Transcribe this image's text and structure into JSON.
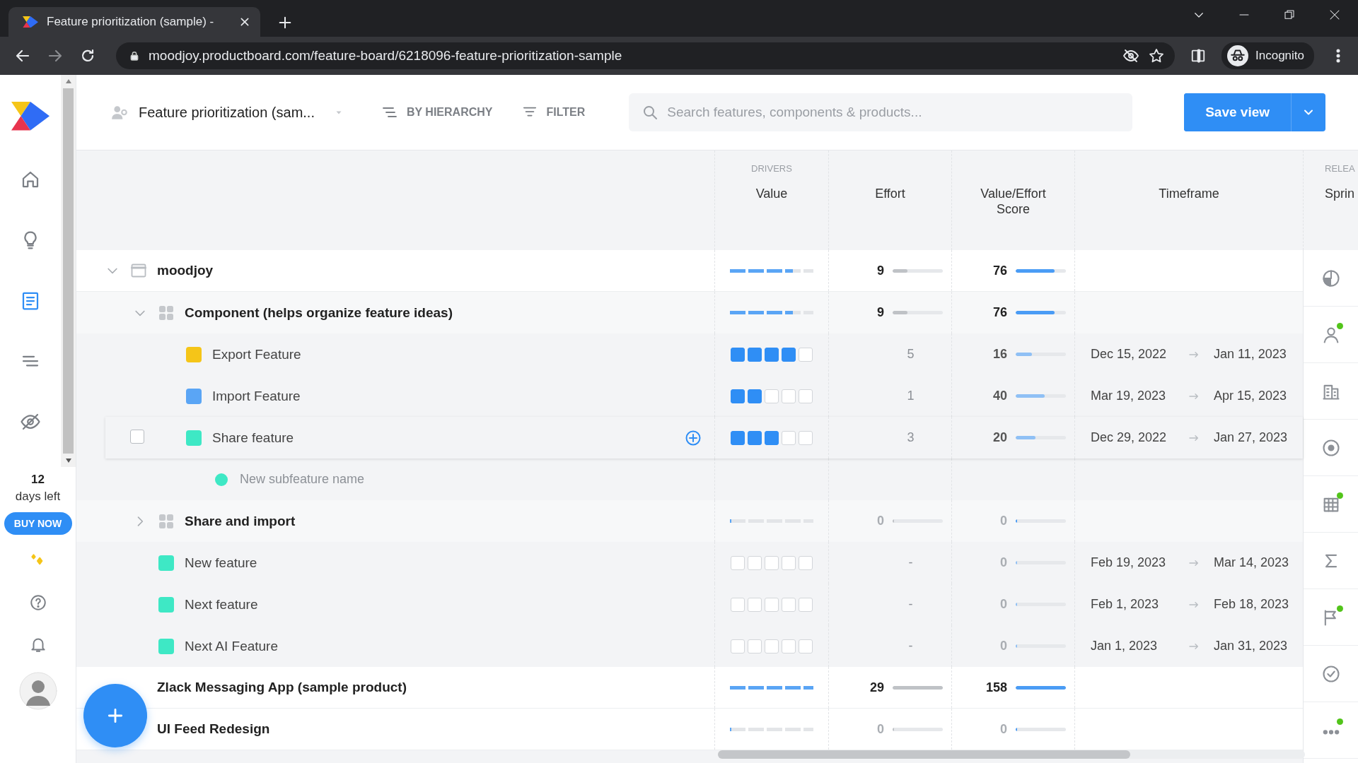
{
  "browser": {
    "tab_title": "Feature prioritization (sample) -",
    "url": "moodjoy.productboard.com/feature-board/6218096-feature-prioritization-sample",
    "profile": "Incognito"
  },
  "nav": {
    "items": [
      {
        "kind": "home",
        "selected": false
      },
      {
        "kind": "insights",
        "selected": false
      },
      {
        "kind": "features",
        "selected": true
      },
      {
        "kind": "roadmap",
        "selected": false
      },
      {
        "kind": "portal",
        "selected": false
      }
    ],
    "trial_days": "12",
    "trial_label": "days left",
    "buy_button": "BUY NOW",
    "bottom_items": [
      {
        "kind": "whats-new"
      },
      {
        "kind": "help"
      },
      {
        "kind": "notifications"
      }
    ]
  },
  "header": {
    "board_title": "Feature prioritization (sam...",
    "group_by": "BY HIERARCHY",
    "filter": "FILTER",
    "search": {
      "placeholder": "Search features, components & products..."
    },
    "save_button": "Save view"
  },
  "columns": {
    "group_label": "DRIVERS",
    "items": [
      "Value",
      "Effort",
      "Value/Effort Score",
      "Timeframe"
    ],
    "next_group_label": "RELEA",
    "next_column": "Sprin"
  },
  "rows": [
    {
      "kind": "product",
      "label": "moodjoy",
      "expanded": true,
      "value": {
        "level": 0.75
      },
      "effort": {
        "text": "9",
        "level": 0.3
      },
      "score": {
        "text": "76",
        "level": 0.78
      },
      "children": [
        {
          "kind": "component",
          "label": "Component (helps organize feature ideas)",
          "expanded": true,
          "value": {
            "level": 0.75
          },
          "effort": {
            "text": "9",
            "level": 0.3
          },
          "score": {
            "text": "76",
            "level": 0.78
          },
          "children": [
            {
              "kind": "feature",
              "label": "Export Feature",
              "color": "#f5c518",
              "value": {
                "stars": 4
              },
              "effort": {
                "text": "5"
              },
              "score": {
                "text": "16",
                "level": 0.33
              },
              "timeframe": {
                "start": "Dec 15, 2022",
                "end": "Jan 11, 2023"
              }
            },
            {
              "kind": "feature",
              "label": "Import Feature",
              "color": "#5aa5f5",
              "value": {
                "stars": 2
              },
              "effort": {
                "text": "1"
              },
              "score": {
                "text": "40",
                "level": 0.58
              },
              "timeframe": {
                "start": "Mar 19, 2023",
                "end": "Apr 15, 2023"
              }
            },
            {
              "kind": "feature",
              "label": "Share feature",
              "color": "#3ee8c5",
              "highlighted": true,
              "checkbox": {
                "checked": false
              },
              "value": {
                "stars": 3
              },
              "effort": {
                "text": "3"
              },
              "score": {
                "text": "20",
                "level": 0.4
              },
              "timeframe": {
                "start": "Dec 29, 2022",
                "end": "Jan 27, 2023"
              },
              "children": [
                {
                  "kind": "new-subfeature",
                  "color": "#3ee8c5",
                  "placeholder": "New subfeature name"
                }
              ]
            }
          ]
        },
        {
          "kind": "component",
          "label": "Share and import",
          "expanded": false,
          "value": {
            "level": 0
          },
          "effort": {
            "text": "0",
            "level": 0
          },
          "score": {
            "text": "0",
            "level": 0
          }
        },
        {
          "kind": "feature",
          "label": "New feature",
          "color": "#3ee8c5",
          "value": {
            "stars": 0
          },
          "effort": {
            "text": "-"
          },
          "score": {
            "text": "0",
            "level": 0
          },
          "timeframe": {
            "start": "Feb 19, 2023",
            "end": "Mar 14, 2023"
          }
        },
        {
          "kind": "feature",
          "label": "Next feature",
          "color": "#3ee8c5",
          "value": {
            "stars": 0
          },
          "effort": {
            "text": "-"
          },
          "score": {
            "text": "0",
            "level": 0
          },
          "timeframe": {
            "start": "Feb 1, 2023",
            "end": "Feb 18, 2023"
          }
        },
        {
          "kind": "feature",
          "label": "Next AI Feature",
          "color": "#3ee8c5",
          "value": {
            "stars": 0
          },
          "effort": {
            "text": "-"
          },
          "score": {
            "text": "0",
            "level": 0
          },
          "timeframe": {
            "start": "Jan 1, 2023",
            "end": "Jan 31, 2023"
          }
        }
      ]
    },
    {
      "kind": "product",
      "label": "Zlack Messaging App (sample product)",
      "value": {
        "level": 1
      },
      "effort": {
        "text": "29",
        "level": 1
      },
      "score": {
        "text": "158",
        "level": 1
      }
    },
    {
      "kind": "product",
      "label": "UI Feed Redesign",
      "value": {
        "level": 0
      },
      "effort": {
        "text": "0",
        "level": 0
      },
      "score": {
        "text": "0",
        "level": 0
      }
    }
  ],
  "side_panel": [
    {
      "kind": "pie",
      "badge": false
    },
    {
      "kind": "person",
      "badge": true
    },
    {
      "kind": "building",
      "badge": false
    },
    {
      "kind": "target",
      "badge": false
    },
    {
      "kind": "table",
      "badge": true
    },
    {
      "kind": "sigma",
      "badge": false
    },
    {
      "kind": "flag",
      "badge": true
    },
    {
      "kind": "check",
      "badge": false
    },
    {
      "kind": "more",
      "badge": true
    }
  ]
}
